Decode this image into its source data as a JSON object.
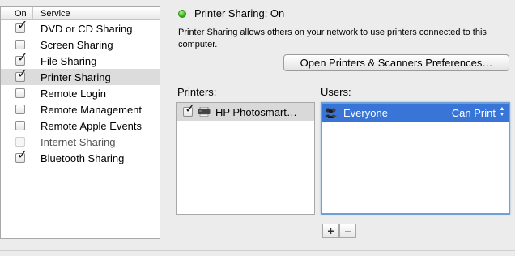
{
  "service_list": {
    "header": {
      "on": "On",
      "service": "Service"
    },
    "items": [
      {
        "label": "DVD or CD Sharing",
        "checked": true,
        "enabled": true,
        "selected": false
      },
      {
        "label": "Screen Sharing",
        "checked": false,
        "enabled": true,
        "selected": false
      },
      {
        "label": "File Sharing",
        "checked": true,
        "enabled": true,
        "selected": false
      },
      {
        "label": "Printer Sharing",
        "checked": true,
        "enabled": true,
        "selected": true
      },
      {
        "label": "Remote Login",
        "checked": false,
        "enabled": true,
        "selected": false
      },
      {
        "label": "Remote Management",
        "checked": false,
        "enabled": true,
        "selected": false
      },
      {
        "label": "Remote Apple Events",
        "checked": false,
        "enabled": true,
        "selected": false
      },
      {
        "label": "Internet Sharing",
        "checked": false,
        "enabled": false,
        "selected": false
      },
      {
        "label": "Bluetooth Sharing",
        "checked": true,
        "enabled": true,
        "selected": false
      }
    ]
  },
  "detail": {
    "status_title": "Printer Sharing: On",
    "status_color": "#39b515",
    "description": "Printer Sharing allows others on your network to use printers connected to this computer.",
    "open_prefs_label": "Open Printers & Scanners Preferences…",
    "printers_label": "Printers:",
    "users_label": "Users:",
    "printers": [
      {
        "name": "HP Photosmart…",
        "checked": true,
        "icon": "printer-icon"
      }
    ],
    "users": [
      {
        "name": "Everyone",
        "permission": "Can Print",
        "icon": "user-group-icon"
      }
    ],
    "add_label": "+",
    "remove_label": "−"
  },
  "colors": {
    "selection_blue": "#3875d7",
    "focus_ring": "#6f9fd8",
    "window_bg": "#ececec"
  }
}
